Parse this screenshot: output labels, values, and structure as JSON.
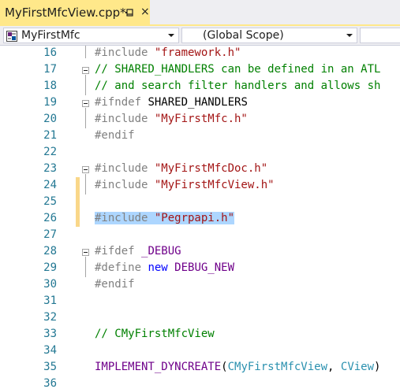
{
  "tab": {
    "title": "MyFirstMfcView.cpp*",
    "pin_icon": "pin-icon",
    "close_glyph": "×"
  },
  "navbar": {
    "project": "MyFirstMfc",
    "scope": "(Global Scope)",
    "extra": ""
  },
  "colors": {
    "tab_active": "#ffe88a",
    "selection": "#add6ff",
    "change_bar": "#f9d789",
    "line_number": "#237893"
  },
  "lines": [
    {
      "num": "16",
      "tokens": [
        {
          "t": "#include ",
          "c": "pre"
        },
        {
          "t": "\"framework.h\"",
          "c": "str"
        }
      ]
    },
    {
      "num": "17",
      "tokens": [
        {
          "t": "// SHARED_HANDLERS can be defined in an ATL",
          "c": "com"
        }
      ]
    },
    {
      "num": "18",
      "tokens": [
        {
          "t": "// and search filter handlers and allows sh",
          "c": "com"
        }
      ]
    },
    {
      "num": "19",
      "tokens": [
        {
          "t": "#ifndef ",
          "c": "pre"
        },
        {
          "t": "SHARED_HANDLERS",
          "c": "plain"
        }
      ]
    },
    {
      "num": "20",
      "tokens": [
        {
          "t": "#include ",
          "c": "pre"
        },
        {
          "t": "\"MyFirstMfc.h\"",
          "c": "str"
        }
      ]
    },
    {
      "num": "21",
      "tokens": [
        {
          "t": "#endif",
          "c": "pre"
        }
      ]
    },
    {
      "num": "22",
      "tokens": []
    },
    {
      "num": "23",
      "tokens": [
        {
          "t": "#include ",
          "c": "pre"
        },
        {
          "t": "\"MyFirstMfcDoc.h\"",
          "c": "str"
        }
      ]
    },
    {
      "num": "24",
      "tokens": [
        {
          "t": "#include ",
          "c": "pre"
        },
        {
          "t": "\"MyFirstMfcView.h\"",
          "c": "str"
        }
      ]
    },
    {
      "num": "25",
      "tokens": []
    },
    {
      "num": "26",
      "tokens": [
        {
          "t": "#include ",
          "c": "pre"
        },
        {
          "t": "\"Pegrpapi.h\"",
          "c": "str"
        }
      ]
    },
    {
      "num": "27",
      "tokens": []
    },
    {
      "num": "28",
      "tokens": [
        {
          "t": "#ifdef ",
          "c": "pre"
        },
        {
          "t": "_DEBUG",
          "c": "mac"
        }
      ]
    },
    {
      "num": "29",
      "tokens": [
        {
          "t": "#define ",
          "c": "pre"
        },
        {
          "t": "new ",
          "c": "kw"
        },
        {
          "t": "DEBUG_NEW",
          "c": "mac"
        }
      ]
    },
    {
      "num": "30",
      "tokens": [
        {
          "t": "#endif",
          "c": "pre"
        }
      ]
    },
    {
      "num": "31",
      "tokens": []
    },
    {
      "num": "32",
      "tokens": []
    },
    {
      "num": "33",
      "tokens": [
        {
          "t": "// CMyFirstMfcView",
          "c": "com"
        }
      ]
    },
    {
      "num": "34",
      "tokens": []
    },
    {
      "num": "35",
      "tokens": [
        {
          "t": "IMPLEMENT_DYNCREATE",
          "c": "mac"
        },
        {
          "t": "(",
          "c": "plain"
        },
        {
          "t": "CMyFirstMfcView",
          "c": "type"
        },
        {
          "t": ", ",
          "c": "plain"
        },
        {
          "t": "CView",
          "c": "type"
        },
        {
          "t": ")",
          "c": "plain"
        }
      ]
    },
    {
      "num": "36",
      "tokens": []
    }
  ]
}
